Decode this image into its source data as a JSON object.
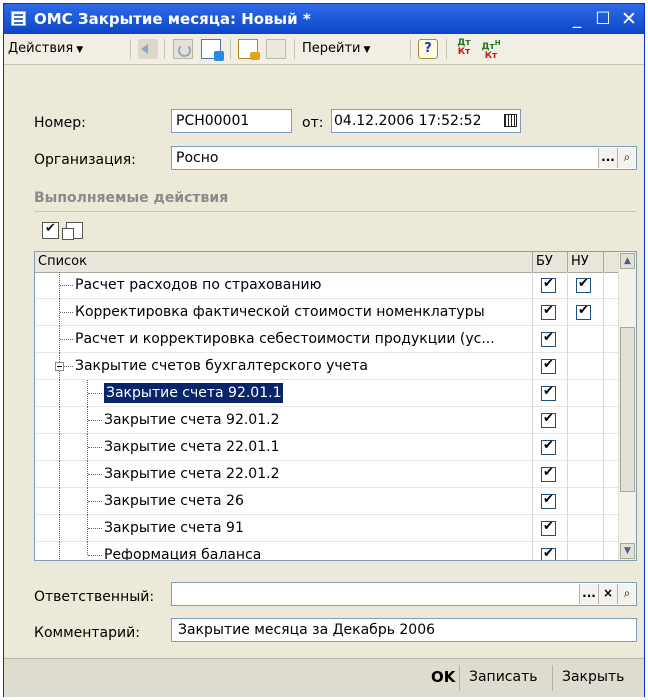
{
  "window": {
    "title": "ОМС Закрытие месяца: Новый *",
    "minimize": "_",
    "maximize": "☐",
    "close": "✕"
  },
  "toolbar": {
    "actions_label": "Действия",
    "goto_label": "Перейти",
    "help_glyph": "?",
    "dtkt_top": "Дт",
    "dtkt_bottom": "Кт",
    "dtkt2_top": "Дт",
    "dtkt2_sup": "Н",
    "dtkt2_bottom": "Кт",
    "dropdown_arrow": "▼"
  },
  "form": {
    "number_label": "Номер:",
    "number_value": "РСН00001",
    "date_label": "от:",
    "date_value": "04.12.2006 17:52:52",
    "org_label": "Организация:",
    "org_value": "Росно",
    "ellipsis": "...",
    "search_glyph": "⌕",
    "clear_glyph": "×",
    "responsible_label": "Ответственный:",
    "responsible_value": "",
    "comment_label": "Комментарий:",
    "comment_value": "Закрытие месяца за Декабрь 2006"
  },
  "actions_section": {
    "title": "Выполняемые действия"
  },
  "table": {
    "columns": [
      "Список",
      "БУ",
      "НУ"
    ],
    "rows": [
      {
        "name": "Расчет расходов по страхованию",
        "bu": true,
        "nu": true,
        "level": 0
      },
      {
        "name": "Корректировка фактической стоимости номенклатуры",
        "bu": true,
        "nu": true,
        "level": 0
      },
      {
        "name": "Расчет и корректировка себестоимости продукции (ус...",
        "bu": true,
        "nu": false,
        "level": 0
      },
      {
        "name": "Закрытие счетов бухгалтерского учета",
        "bu": true,
        "nu": false,
        "level": 0,
        "group": true
      },
      {
        "name": "Закрытие счета 92.01.1",
        "bu": true,
        "nu": false,
        "level": 1,
        "selected": true
      },
      {
        "name": "Закрытие счета 92.01.2",
        "bu": true,
        "nu": false,
        "level": 1
      },
      {
        "name": "Закрытие счета 22.01.1",
        "bu": true,
        "nu": false,
        "level": 1
      },
      {
        "name": "Закрытие счета 22.01.2",
        "bu": true,
        "nu": false,
        "level": 1
      },
      {
        "name": "Закрытие счета 26",
        "bu": true,
        "nu": false,
        "level": 1
      },
      {
        "name": "Закрытие счета 91",
        "bu": true,
        "nu": false,
        "level": 1
      },
      {
        "name": "Реформация баланса",
        "bu": true,
        "nu": false,
        "level": 1
      }
    ]
  },
  "scroll": {
    "up": "▲",
    "down": "▼"
  },
  "buttons": {
    "ok": "OK",
    "save": "Записать",
    "close": "Закрыть"
  }
}
